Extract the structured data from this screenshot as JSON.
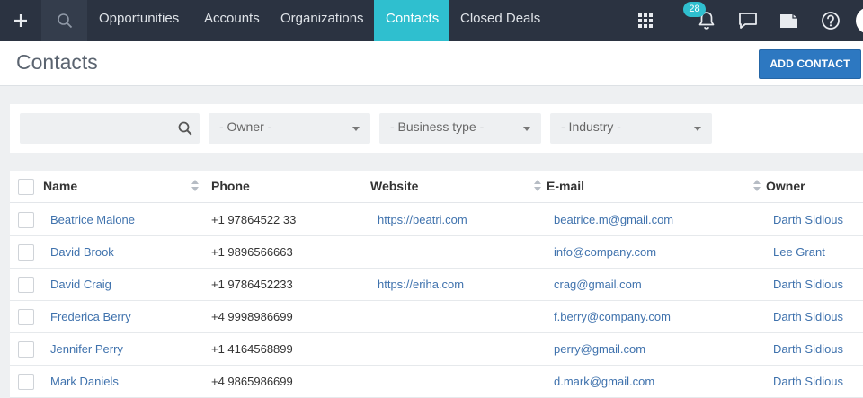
{
  "topbar": {
    "tabs": [
      {
        "label": "Opportunities",
        "active": false
      },
      {
        "label": "Accounts",
        "active": false
      },
      {
        "label": "Organizations",
        "active": false
      },
      {
        "label": "Contacts",
        "active": true
      },
      {
        "label": "Closed Deals",
        "active": false
      }
    ],
    "notification_count": "28",
    "icons": [
      "plus-icon",
      "search-icon",
      "apps-grid-icon",
      "bell-icon",
      "chat-icon",
      "folder-icon",
      "help-icon"
    ],
    "colors": {
      "bar": "#2b3341",
      "active_tab": "#2fbfcf",
      "badge": "#2fbfcf"
    }
  },
  "header": {
    "title": "Contacts",
    "add_button": "ADD CONTACT",
    "button_color": "#2d78c1"
  },
  "filters": {
    "search_placeholder": "",
    "owner": "- Owner -",
    "business_type": "- Business type -",
    "industry": "- Industry -"
  },
  "table": {
    "columns": [
      "Name",
      "Phone",
      "Website",
      "E-mail",
      "Owner"
    ],
    "rows": [
      {
        "name": "Beatrice Malone",
        "phone": "+1 97864522 33",
        "website": "https://beatri.com",
        "email": "beatrice.m@gmail.com",
        "owner": "Darth Sidious"
      },
      {
        "name": "David Brook",
        "phone": "+1 9896566663",
        "website": "",
        "email": "info@company.com",
        "owner": "Lee Grant"
      },
      {
        "name": "David Craig",
        "phone": "+1 9786452233",
        "website": "https://eriha.com",
        "email": "crag@gmail.com",
        "owner": "Darth Sidious"
      },
      {
        "name": "Frederica Berry",
        "phone": "+4 9998986699",
        "website": "",
        "email": "f.berry@company.com",
        "owner": "Darth Sidious"
      },
      {
        "name": "Jennifer Perry",
        "phone": "+1 4164568899",
        "website": "",
        "email": "perry@gmail.com",
        "owner": "Darth Sidious"
      },
      {
        "name": "Mark Daniels",
        "phone": "+4 9865986699",
        "website": "",
        "email": "d.mark@gmail.com",
        "owner": "Darth Sidious"
      }
    ],
    "link_color": "#3f72ad"
  }
}
